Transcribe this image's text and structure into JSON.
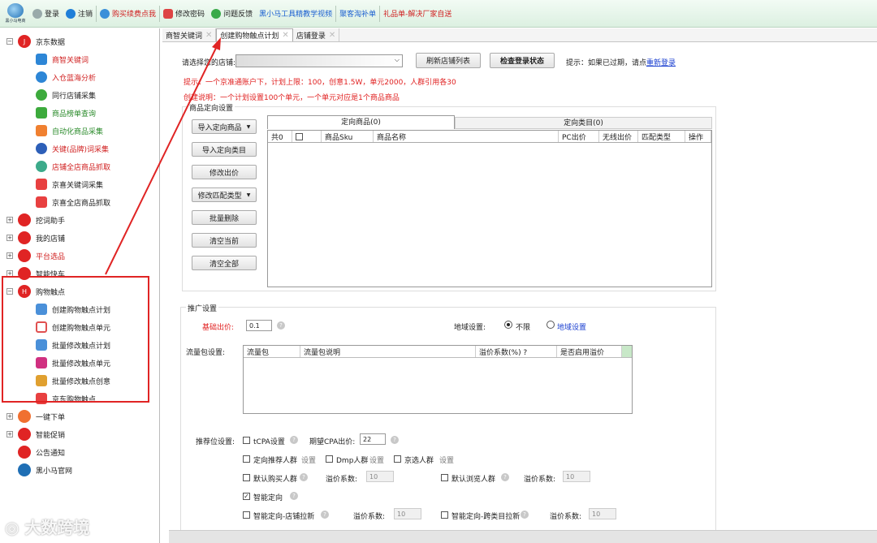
{
  "toolbar": {
    "logo_text": "黑小马电商",
    "login": "登录",
    "logout": "注销",
    "buy": "购买续费点我",
    "change_password": "修改密码",
    "feedback": "问题反馈",
    "video": "黑小马工具精教学视频",
    "juhaitao": "聚客淘补单",
    "gift": "礼品单-解决厂家自送"
  },
  "sidebar": {
    "jd_data": "京东数据",
    "jd_children": [
      "商智关键词",
      "入仓蓝海分析",
      "同行店铺采集",
      "商品榜单查询",
      "自动化商品采集",
      "关键(品牌)词采集",
      "店铺全店商品抓取",
      "京喜关键词采集",
      "京喜全店商品抓取"
    ],
    "dig": "挖词助手",
    "my_shop": "我的店铺",
    "platform": "平台选品",
    "express": "智能快车",
    "touch": "购物触点",
    "touch_children": [
      "创建购物触点计划",
      "创建购物触点单元",
      "批量修改触点计划",
      "批量修改触点单元",
      "批量修改触点创意",
      "京东购物触点"
    ],
    "one_order": "一键下单",
    "promo": "智能促销",
    "notice": "公告通知",
    "official": "黑小马官网"
  },
  "tabs": [
    "商智关键词",
    "创建购物触点计划",
    "店铺登录"
  ],
  "main": {
    "shop_label": "请选择您的店铺:",
    "refresh_btn": "刷新店铺列表",
    "check_btn": "检查登录状态",
    "tip_expired": "提示：如果已过期，请点",
    "relogin": "重新登录",
    "hint1": "提示：一个京准通账户下，计划上限：100，创意1.5W，单元2000，人群引用各30",
    "hint2": "创建说明：一个计划设置100个单元，一个单元对应是1个商品商品",
    "group_title": "商品定向设置",
    "buttons": [
      "导入定向商品",
      "导入定向类目",
      "修改出价",
      "修改匹配类型",
      "批量删除",
      "清空当前",
      "清空全部"
    ],
    "subtab1": "定向商品(0)",
    "subtab2": "定向类目(0)",
    "grid_cols": [
      "共0",
      "",
      "商品Sku",
      "商品名称",
      "PC出价",
      "无线出价",
      "匹配类型",
      "操作"
    ],
    "promo_title": "推广设置",
    "base_bid_label": "基础出价:",
    "base_bid": "0.1",
    "region_label": "地域设置:",
    "region_unlimited": "不限",
    "region_setting": "地域设置",
    "flow_label": "流量包设置:",
    "flow_cols": [
      "流量包",
      "流量包说明",
      "溢价系数(%) ?",
      "是否启用溢价"
    ],
    "rec_label": "推荐位设置:",
    "tcpa": "tCPA设置",
    "expect_cpa": "期望CPA出价:",
    "expect_cpa_val": "22",
    "target_rec": "定向推荐人群",
    "set": "设置",
    "dmp": "Dmp人群",
    "jd_select": "京选人群",
    "default_buy": "默认购买人群",
    "premium": "溢价系数:",
    "premium_val": "10",
    "default_browse": "默认浏览人群",
    "smart_target": "智能定向",
    "smart_shop": "智能定向-店铺拉新",
    "smart_cross": "智能定向-跨类目拉新"
  },
  "watermark": "大数跨境"
}
